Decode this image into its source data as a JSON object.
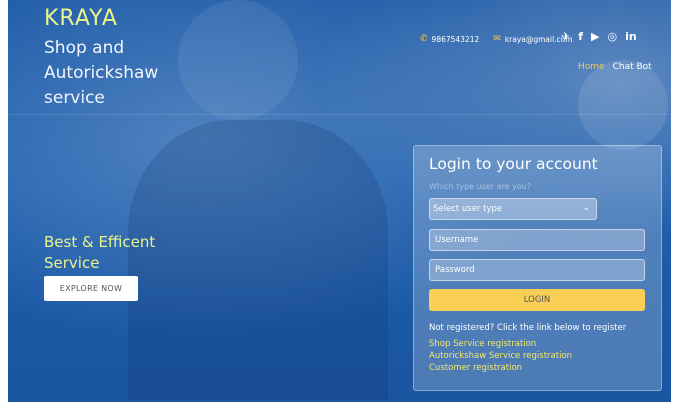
{
  "brand": {
    "name": "KRAYA",
    "tagline": "Shop and Autorickshaw service"
  },
  "contact": {
    "phone": "9867543212",
    "email": "kraya@gmail.com"
  },
  "social": {
    "icons": [
      "twitter-icon",
      "facebook-icon",
      "youtube-icon",
      "instagram-icon",
      "linkedin-icon"
    ],
    "twitter": "𝕿",
    "facebook": "f",
    "youtube": "▶",
    "instagram": "◎",
    "linkedin": "in"
  },
  "nav": {
    "home": "Home",
    "chat": "Chat Bot"
  },
  "hero": {
    "headline": "Best & Efficent Service",
    "explore_label": "EXPLORE NOW"
  },
  "login": {
    "title": "Login to your account",
    "subtitle": "Which type user are you?",
    "select_value": "Select user type",
    "username_placeholder": "Username",
    "password_placeholder": "Password",
    "button_label": "LOGIN",
    "register_note": "Not registered? Click the link below to register",
    "links": {
      "shop": "Shop Service registration",
      "auto": "Autorickshaw Service registration",
      "customer": "Customer registration"
    }
  },
  "colors": {
    "accent": "#f9cf55",
    "brand_text": "#e9f58a",
    "link": "#f5e96a",
    "background": "#1e5fad"
  }
}
